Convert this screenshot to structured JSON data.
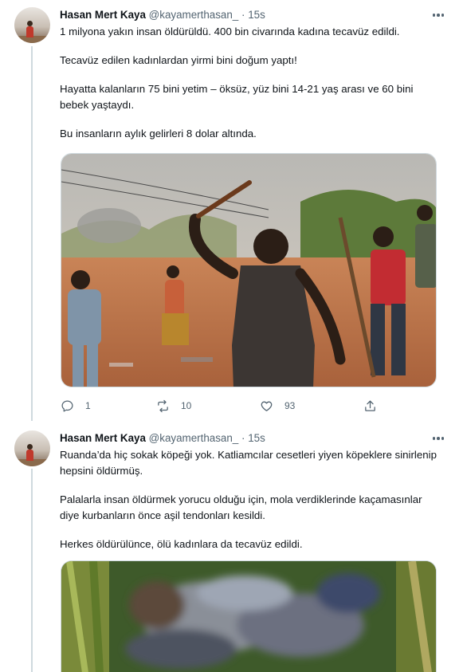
{
  "tweets": [
    {
      "author": {
        "name": "Hasan Mert Kaya",
        "handle": "@kayamerthasan_",
        "separator": "·",
        "time": "15s"
      },
      "paragraphs": [
        "1 milyona yakın insan öldürüldü. 400 bin civarında kadına tecavüz edildi.",
        "Tecavüz edilen kadınlardan yirmi bini doğum yaptı!",
        "Hayatta kalanların 75 bini yetim – öksüz, yüz bini 14-21 yaş arası ve 60 bini bebek yaştaydı.",
        "Bu insanların aylık gelirleri 8 dolar altında."
      ],
      "stats": {
        "replies": "1",
        "retweets": "10",
        "likes": "93"
      }
    },
    {
      "author": {
        "name": "Hasan Mert Kaya",
        "handle": "@kayamerthasan_",
        "separator": "·",
        "time": "15s"
      },
      "paragraphs": [
        "Ruanda’da hiç sokak köpeği yok. Katliamcılar cesetleri yiyen köpeklere sinirlenip hepsini öldürmüş.",
        "Palalarla insan öldürmek yorucu olduğu için, mola verdiklerinde kaçamasınlar diye kurbanların önce aşil tendonları kesildi.",
        "Herkes öldürülünce, ölü kadınlara da tecavüz edildi."
      ]
    }
  ],
  "icons": {
    "more": "more-horizontal-icon",
    "reply": "reply-icon",
    "retweet": "retweet-icon",
    "like": "heart-icon",
    "share": "share-icon"
  },
  "colors": {
    "text": "#0f1419",
    "secondary": "#536471",
    "border": "#cfd9de"
  }
}
